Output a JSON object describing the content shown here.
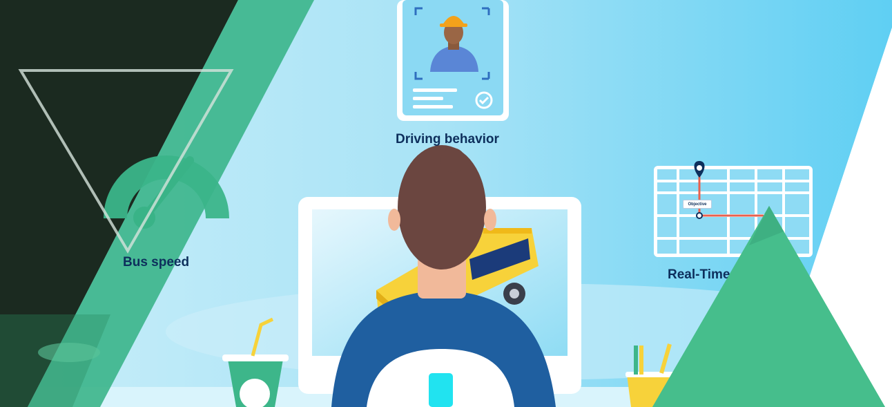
{
  "labels": {
    "driving_behavior": "Driving behavior",
    "bus_speed": "Bus speed",
    "real_time": "Real-Time T",
    "objective": "Objective"
  },
  "colors": {
    "dark_panel": "#1b2a20",
    "green_accent": "#3bb58a",
    "sky_light": "#bfe9f8",
    "sky_blue": "#63d0f2",
    "text_navy": "#0d2f5c",
    "bus_yellow": "#f7d23a",
    "hair_brown": "#6b4640",
    "shirt_blue": "#1f5fa0"
  },
  "icons": {
    "speedometer": "speedometer-icon",
    "worker_badge": "worker-id-card-icon",
    "map": "map-route-icon",
    "location_pin": "location-pin-icon",
    "check": "check-circle-icon"
  }
}
